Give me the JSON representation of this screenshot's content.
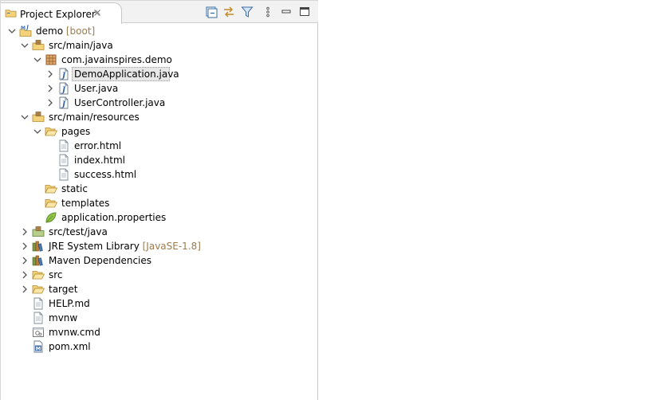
{
  "panel": {
    "title": "Project Explorer",
    "toolbar": [
      "collapse-all-icon",
      "link-with-editor-icon",
      "filter-icon",
      "view-menu-icon",
      "minimize-icon",
      "maximize-icon"
    ]
  },
  "tree": {
    "demo": {
      "label": "demo",
      "decoration": "[boot]"
    },
    "src_main_java": {
      "label": "src/main/java"
    },
    "package": {
      "label": "com.javainspires.demo"
    },
    "demo_app": {
      "label": "DemoApplication.java"
    },
    "user_java": {
      "label": "User.java"
    },
    "user_controller": {
      "label": "UserController.java"
    },
    "src_main_resources": {
      "label": "src/main/resources"
    },
    "pages": {
      "label": "pages"
    },
    "error_html": {
      "label": "error.html"
    },
    "index_html": {
      "label": "index.html"
    },
    "success_html": {
      "label": "success.html"
    },
    "static": {
      "label": "static"
    },
    "templates": {
      "label": "templates"
    },
    "app_props": {
      "label": "application.properties"
    },
    "src_test_java": {
      "label": "src/test/java"
    },
    "jre": {
      "label": "JRE System Library",
      "decoration": "[JavaSE-1.8]"
    },
    "maven_deps": {
      "label": "Maven Dependencies"
    },
    "src": {
      "label": "src"
    },
    "target": {
      "label": "target"
    },
    "help_md": {
      "label": "HELP.md"
    },
    "mvnw": {
      "label": "mvnw"
    },
    "mvnw_cmd": {
      "label": "mvnw.cmd"
    },
    "pom_xml": {
      "label": "pom.xml"
    }
  },
  "colors": {
    "folder": "#e8c26a",
    "java_blue": "#3a6ea5",
    "decoration": "#9a7c50",
    "selection": "#e7e7e7"
  }
}
